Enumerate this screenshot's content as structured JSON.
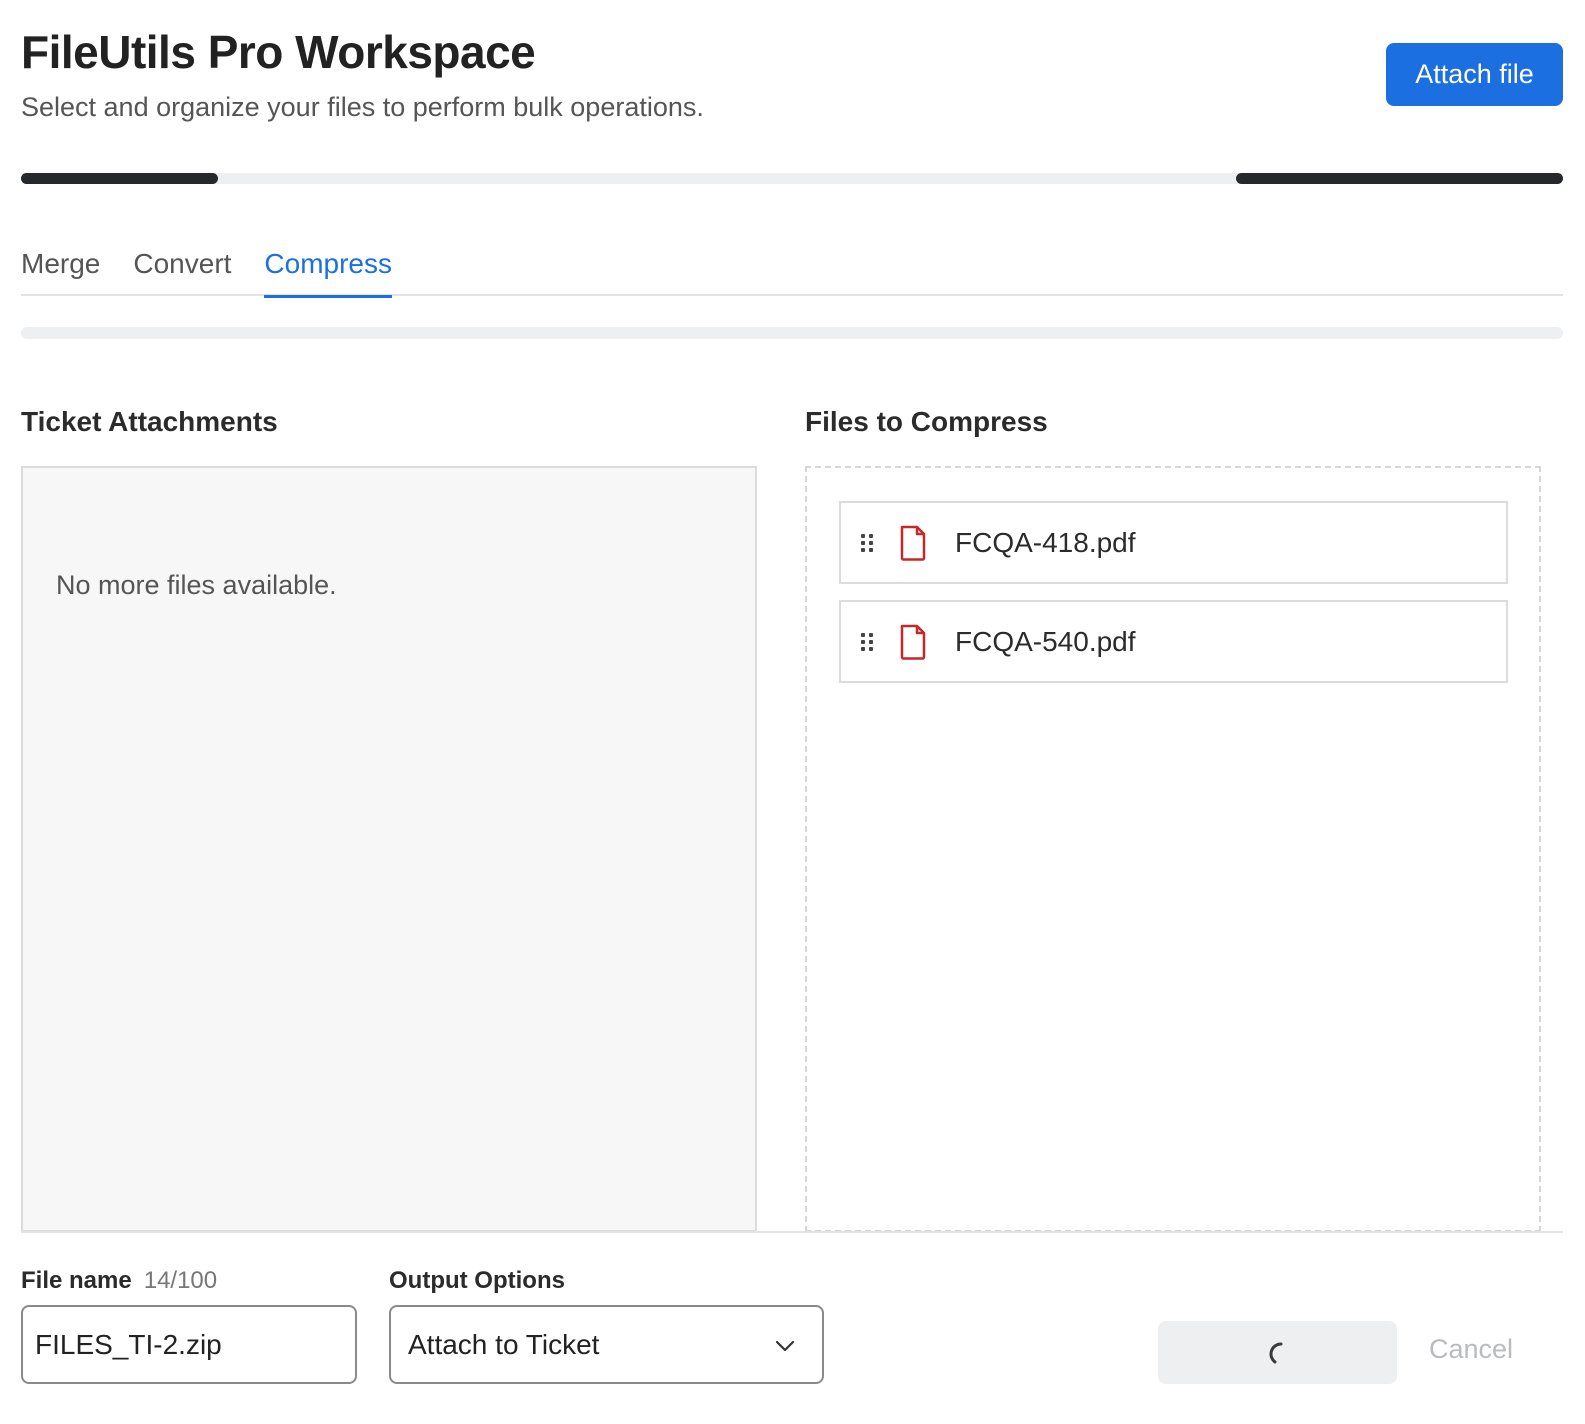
{
  "header": {
    "title": "FileUtils Pro Workspace",
    "subtitle": "Select and organize your files to perform bulk operations.",
    "attach_label": "Attach file"
  },
  "colors": {
    "accent": "#1c6fe0",
    "pdf_icon": "#c62828",
    "dark_bar": "#26282b"
  },
  "tabs": [
    {
      "label": "Merge",
      "active": false
    },
    {
      "label": "Convert",
      "active": false
    },
    {
      "label": "Compress",
      "active": true
    }
  ],
  "left_panel": {
    "title": "Ticket Attachments",
    "empty_message": "No more files available."
  },
  "right_panel": {
    "title": "Files to Compress",
    "files": [
      {
        "name": "FCQA-418.pdf",
        "icon": "pdf-file-icon"
      },
      {
        "name": "FCQA-540.pdf",
        "icon": "pdf-file-icon"
      }
    ]
  },
  "footer": {
    "file_name_label": "File name",
    "file_name_count": "14/100",
    "file_name_value": "FILES_TI-2.zip",
    "output_label": "Output Options",
    "output_value": "Attach to Ticket",
    "submit_icon": "loading-spinner-icon",
    "cancel_label": "Cancel"
  }
}
